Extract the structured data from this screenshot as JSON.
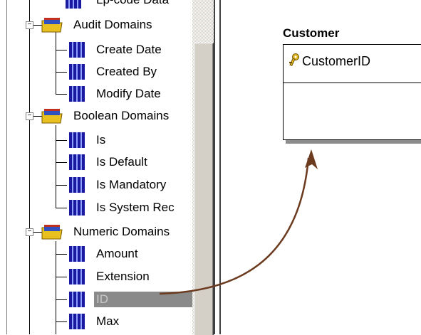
{
  "tree": {
    "partial_top_label": "Lp-code Data",
    "groups": [
      {
        "label": "Audit Domains",
        "items": [
          "Create Date",
          "Created By",
          "Modify Date"
        ]
      },
      {
        "label": "Boolean Domains",
        "items": [
          "Is",
          "Is Default",
          "Is Mandatory",
          "Is System Rec"
        ]
      },
      {
        "label": "Numeric Domains",
        "items": [
          "Amount",
          "Extension",
          "ID",
          "Max"
        ]
      }
    ],
    "selected_item": "ID"
  },
  "entity": {
    "title": "Customer",
    "primary_key": "CustomerID",
    "key_icon": "key-icon"
  },
  "colors": {
    "selection_bg": "#8a8a8a",
    "arrow": "#6b3a1f",
    "shadow": "#8c8c8c"
  }
}
